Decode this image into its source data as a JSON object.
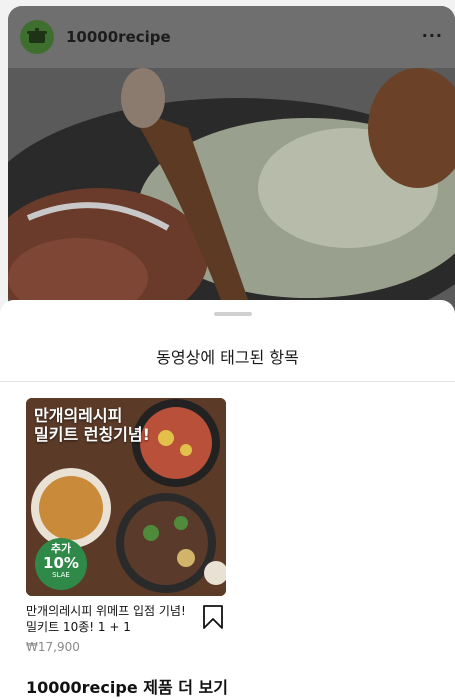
{
  "post": {
    "account_name": "10000recipe",
    "more_label": "···"
  },
  "tag_sheet": {
    "title": "동영상에 태그된 항목"
  },
  "product": {
    "image_text_line1": "만개의레시피",
    "image_text_line2": "밀키트 런칭기념!",
    "badge_line1": "추가",
    "badge_line2": "10%",
    "badge_line3": "SLAE",
    "title": "만개의레시피 위메프 입점 기념! 밀키트 10종! 1 + 1",
    "price": "₩17,900"
  },
  "footer": {
    "more_products": "10000recipe 제품 더 보기"
  }
}
